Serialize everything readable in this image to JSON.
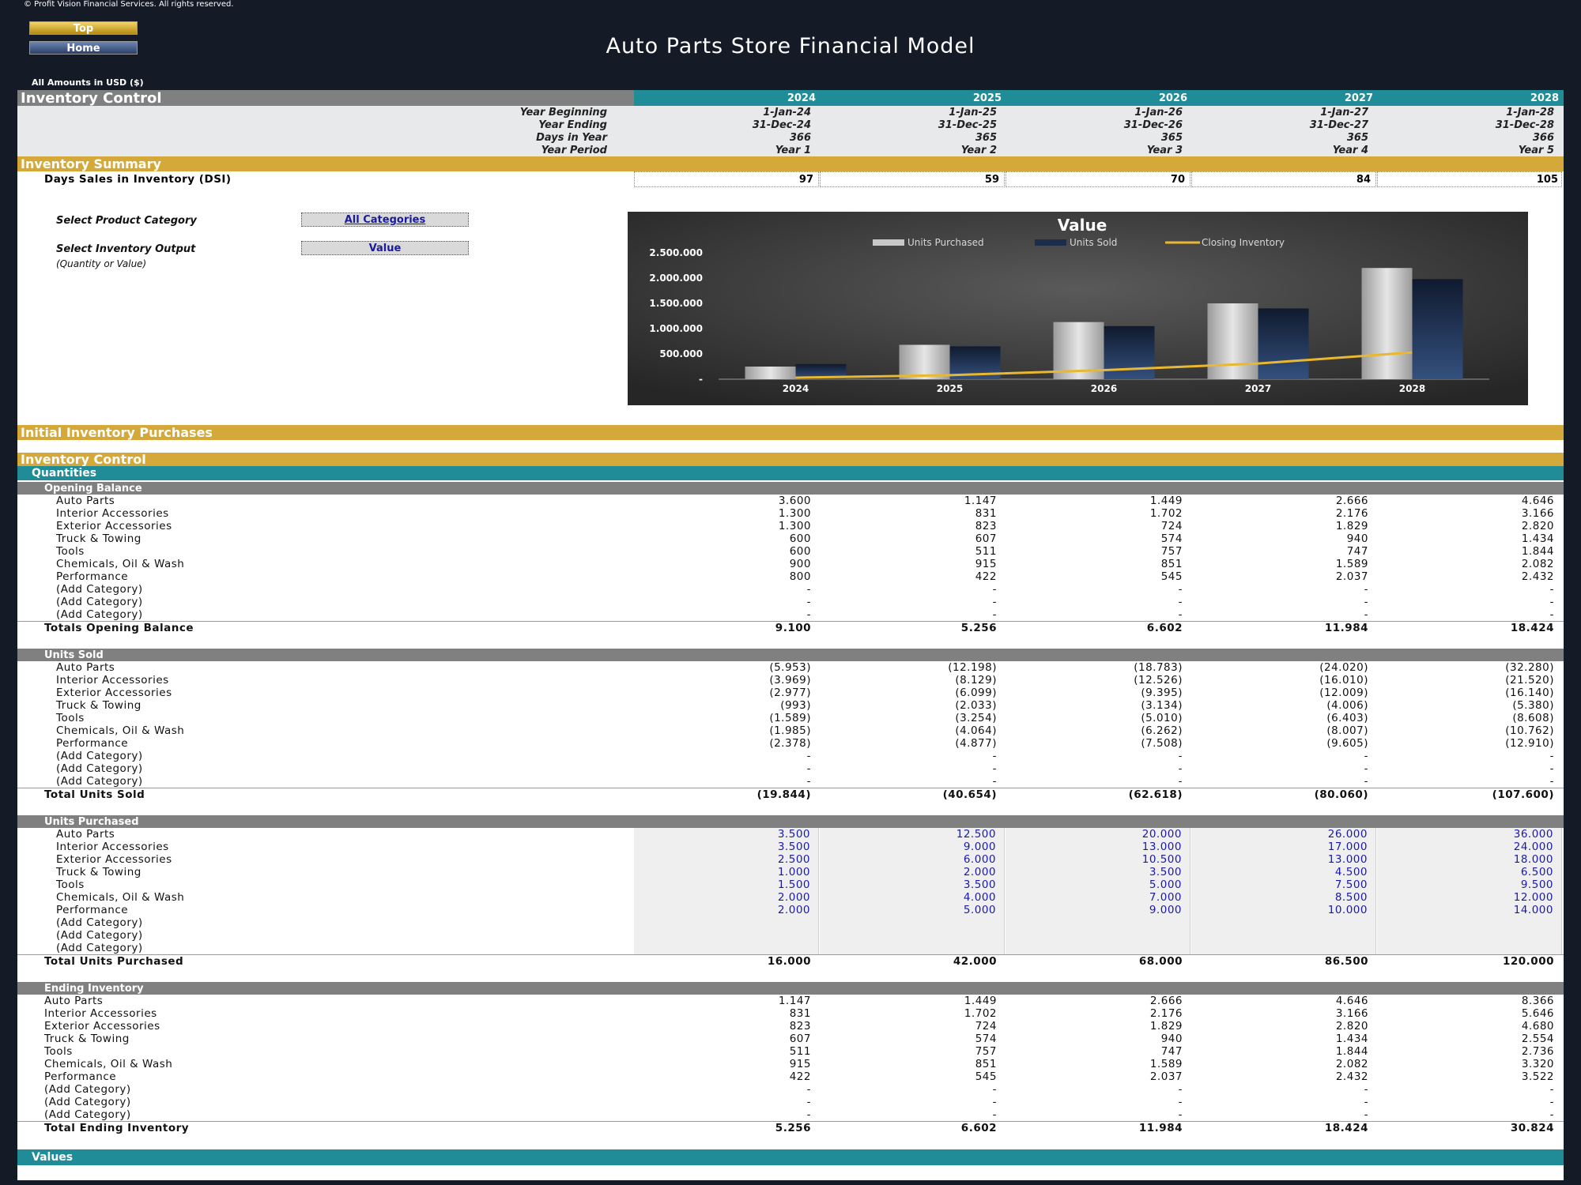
{
  "copyright": "© Profit Vision Financial Services. All rights reserved.",
  "nav": {
    "top": "Top",
    "home": "Home"
  },
  "title": "Auto Parts Store Financial Model",
  "amounts_note": "All Amounts in  USD ($)",
  "header": {
    "section": "Inventory Control",
    "years": [
      "2024",
      "2025",
      "2026",
      "2027",
      "2028"
    ],
    "info_rows": [
      {
        "label": "Year Beginning",
        "values": [
          "1-Jan-24",
          "1-Jan-25",
          "1-Jan-26",
          "1-Jan-27",
          "1-Jan-28"
        ]
      },
      {
        "label": "Year Ending",
        "values": [
          "31-Dec-24",
          "31-Dec-25",
          "31-Dec-26",
          "31-Dec-27",
          "31-Dec-28"
        ]
      },
      {
        "label": "Days in Year",
        "values": [
          "366",
          "365",
          "365",
          "365",
          "366"
        ]
      },
      {
        "label": "Year Period",
        "values": [
          "Year 1",
          "Year 2",
          "Year 3",
          "Year 4",
          "Year 5"
        ]
      }
    ]
  },
  "summary": {
    "title": "Inventory Summary",
    "dsi_label": "Days Sales in Inventory (DSI)",
    "dsi_values": [
      "97",
      "59",
      "70",
      "84",
      "105"
    ],
    "select_category_label": "Select Product Category",
    "select_category_value": "All Categories",
    "select_output_label": "Select Inventory Output",
    "select_output_value": "Value",
    "select_output_note": "(Quantity or Value)"
  },
  "chart_data": {
    "type": "bar",
    "title": "Value",
    "categories": [
      "2024",
      "2025",
      "2026",
      "2027",
      "2028"
    ],
    "series": [
      {
        "name": "Units Purchased",
        "type": "bar",
        "values": [
          250000,
          680000,
          1130000,
          1500000,
          2200000
        ]
      },
      {
        "name": "Units Sold",
        "type": "bar",
        "values": [
          300000,
          650000,
          1050000,
          1400000,
          1980000
        ]
      },
      {
        "name": "Closing Inventory",
        "type": "line",
        "values": [
          30000,
          80000,
          180000,
          310000,
          530000
        ]
      }
    ],
    "y_ticks": [
      "-",
      "500.000",
      "1.000.000",
      "1.500.000",
      "2.000.000",
      "2.500.000"
    ],
    "ylim": [
      0,
      2500000
    ],
    "legend": "top",
    "grid": false,
    "colors": {
      "purchased": "#c8c8c8",
      "sold": "#1c2d4c",
      "closing": "#e8b830"
    }
  },
  "initial_purchases": {
    "title": "Initial Inventory Purchases"
  },
  "inventory_control": {
    "title": "Inventory Control",
    "quantities_title": "Quantities",
    "opening": {
      "title": "Opening Balance",
      "rows": [
        {
          "label": "Auto Parts",
          "values": [
            "3.600",
            "1.147",
            "1.449",
            "2.666",
            "4.646"
          ]
        },
        {
          "label": "Interior Accessories",
          "values": [
            "1.300",
            "831",
            "1.702",
            "2.176",
            "3.166"
          ]
        },
        {
          "label": "Exterior Accessories",
          "values": [
            "1.300",
            "823",
            "724",
            "1.829",
            "2.820"
          ]
        },
        {
          "label": "Truck & Towing",
          "values": [
            "600",
            "607",
            "574",
            "940",
            "1.434"
          ]
        },
        {
          "label": "Tools",
          "values": [
            "600",
            "511",
            "757",
            "747",
            "1.844"
          ]
        },
        {
          "label": "Chemicals, Oil & Wash",
          "values": [
            "900",
            "915",
            "851",
            "1.589",
            "2.082"
          ]
        },
        {
          "label": "Performance",
          "values": [
            "800",
            "422",
            "545",
            "2.037",
            "2.432"
          ]
        },
        {
          "label": "(Add Category)",
          "values": [
            "-",
            "-",
            "-",
            "-",
            "-"
          ]
        },
        {
          "label": "(Add Category)",
          "values": [
            "-",
            "-",
            "-",
            "-",
            "-"
          ]
        },
        {
          "label": "(Add Category)",
          "values": [
            "-",
            "-",
            "-",
            "-",
            "-"
          ]
        }
      ],
      "total_label": "Totals Opening Balance",
      "total_values": [
        "9.100",
        "5.256",
        "6.602",
        "11.984",
        "18.424"
      ]
    },
    "sold": {
      "title": "Units Sold",
      "rows": [
        {
          "label": "Auto Parts",
          "values": [
            "(5.953)",
            "(12.198)",
            "(18.783)",
            "(24.020)",
            "(32.280)"
          ]
        },
        {
          "label": "Interior Accessories",
          "values": [
            "(3.969)",
            "(8.129)",
            "(12.526)",
            "(16.010)",
            "(21.520)"
          ]
        },
        {
          "label": "Exterior Accessories",
          "values": [
            "(2.977)",
            "(6.099)",
            "(9.395)",
            "(12.009)",
            "(16.140)"
          ]
        },
        {
          "label": "Truck & Towing",
          "values": [
            "(993)",
            "(2.033)",
            "(3.134)",
            "(4.006)",
            "(5.380)"
          ]
        },
        {
          "label": "Tools",
          "values": [
            "(1.589)",
            "(3.254)",
            "(5.010)",
            "(6.403)",
            "(8.608)"
          ]
        },
        {
          "label": "Chemicals, Oil & Wash",
          "values": [
            "(1.985)",
            "(4.064)",
            "(6.262)",
            "(8.007)",
            "(10.762)"
          ]
        },
        {
          "label": "Performance",
          "values": [
            "(2.378)",
            "(4.877)",
            "(7.508)",
            "(9.605)",
            "(12.910)"
          ]
        },
        {
          "label": "(Add Category)",
          "values": [
            "-",
            "-",
            "-",
            "-",
            "-"
          ]
        },
        {
          "label": "(Add Category)",
          "values": [
            "-",
            "-",
            "-",
            "-",
            "-"
          ]
        },
        {
          "label": "(Add Category)",
          "values": [
            "-",
            "-",
            "-",
            "-",
            "-"
          ]
        }
      ],
      "total_label": "Total Units Sold",
      "total_values": [
        "(19.844)",
        "(40.654)",
        "(62.618)",
        "(80.060)",
        "(107.600)"
      ]
    },
    "purchased": {
      "title": "Units Purchased",
      "rows": [
        {
          "label": "Auto Parts",
          "values": [
            "3.500",
            "12.500",
            "20.000",
            "26.000",
            "36.000"
          ]
        },
        {
          "label": "Interior Accessories",
          "values": [
            "3.500",
            "9.000",
            "13.000",
            "17.000",
            "24.000"
          ]
        },
        {
          "label": "Exterior Accessories",
          "values": [
            "2.500",
            "6.000",
            "10.500",
            "13.000",
            "18.000"
          ]
        },
        {
          "label": "Truck & Towing",
          "values": [
            "1.000",
            "2.000",
            "3.500",
            "4.500",
            "6.500"
          ]
        },
        {
          "label": "Tools",
          "values": [
            "1.500",
            "3.500",
            "5.000",
            "7.500",
            "9.500"
          ]
        },
        {
          "label": "Chemicals, Oil & Wash",
          "values": [
            "2.000",
            "4.000",
            "7.000",
            "8.500",
            "12.000"
          ]
        },
        {
          "label": "Performance",
          "values": [
            "2.000",
            "5.000",
            "9.000",
            "10.000",
            "14.000"
          ]
        },
        {
          "label": "(Add Category)",
          "values": [
            "",
            "",
            "",
            "",
            ""
          ]
        },
        {
          "label": "(Add Category)",
          "values": [
            "",
            "",
            "",
            "",
            ""
          ]
        },
        {
          "label": "(Add Category)",
          "values": [
            "",
            "",
            "",
            "",
            ""
          ]
        }
      ],
      "total_label": "Total Units Purchased",
      "total_values": [
        "16.000",
        "42.000",
        "68.000",
        "86.500",
        "120.000"
      ]
    },
    "ending": {
      "title": "Ending Inventory",
      "rows": [
        {
          "label": "Auto Parts",
          "values": [
            "1.147",
            "1.449",
            "2.666",
            "4.646",
            "8.366"
          ]
        },
        {
          "label": "Interior Accessories",
          "values": [
            "831",
            "1.702",
            "2.176",
            "3.166",
            "5.646"
          ]
        },
        {
          "label": "Exterior Accessories",
          "values": [
            "823",
            "724",
            "1.829",
            "2.820",
            "4.680"
          ]
        },
        {
          "label": "Truck & Towing",
          "values": [
            "607",
            "574",
            "940",
            "1.434",
            "2.554"
          ]
        },
        {
          "label": "Tools",
          "values": [
            "511",
            "757",
            "747",
            "1.844",
            "2.736"
          ]
        },
        {
          "label": "Chemicals, Oil & Wash",
          "values": [
            "915",
            "851",
            "1.589",
            "2.082",
            "3.320"
          ]
        },
        {
          "label": "Performance",
          "values": [
            "422",
            "545",
            "2.037",
            "2.432",
            "3.522"
          ]
        },
        {
          "label": "(Add Category)",
          "values": [
            "-",
            "-",
            "-",
            "-",
            "-"
          ]
        },
        {
          "label": "(Add Category)",
          "values": [
            "-",
            "-",
            "-",
            "-",
            "-"
          ]
        },
        {
          "label": "(Add Category)",
          "values": [
            "-",
            "-",
            "-",
            "-",
            "-"
          ]
        }
      ],
      "total_label": "Total Ending Inventory",
      "total_values": [
        "5.256",
        "6.602",
        "11.984",
        "18.424",
        "30.824"
      ]
    },
    "values_title": "Values"
  }
}
